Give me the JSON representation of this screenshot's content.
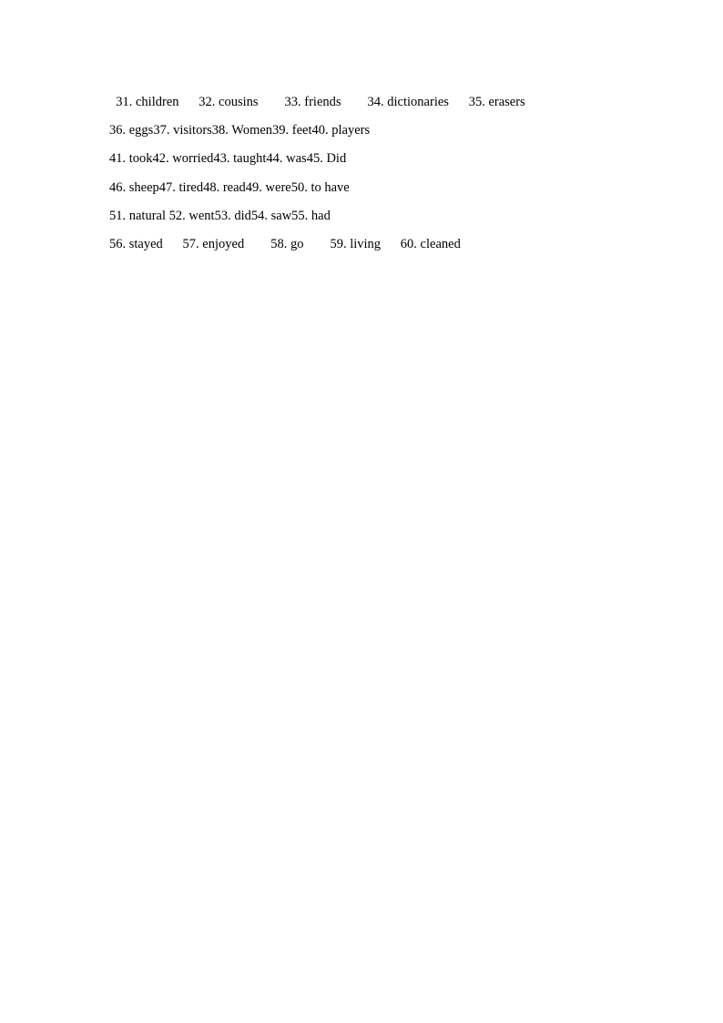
{
  "answers": {
    "rows": [
      {
        "indent": "  ",
        "items": [
          {
            "num": "31",
            "ans": "children",
            "after": "      "
          },
          {
            "num": "32",
            "ans": "cousins",
            "after": "        "
          },
          {
            "num": "33",
            "ans": "friends",
            "after": "        "
          },
          {
            "num": "34",
            "ans": "dictionaries",
            "after": "      "
          },
          {
            "num": "35",
            "ans": "erasers",
            "after": ""
          }
        ]
      },
      {
        "indent": "",
        "items": [
          {
            "num": "36",
            "ans": "eggs",
            "after": ""
          },
          {
            "num": "37",
            "ans": "visitors",
            "after": ""
          },
          {
            "num": "38",
            "ans": "Women",
            "after": ""
          },
          {
            "num": "39",
            "ans": "feet",
            "after": ""
          },
          {
            "num": "40",
            "ans": "players",
            "after": ""
          }
        ]
      },
      {
        "indent": "",
        "items": [
          {
            "num": "41",
            "ans": "took",
            "after": ""
          },
          {
            "num": "42",
            "ans": "worried",
            "after": ""
          },
          {
            "num": "43",
            "ans": "taught",
            "after": ""
          },
          {
            "num": "44",
            "ans": "was",
            "after": ""
          },
          {
            "num": "45",
            "ans": "Did",
            "after": ""
          }
        ]
      },
      {
        "indent": "",
        "items": [
          {
            "num": "46",
            "ans": "sheep",
            "after": ""
          },
          {
            "num": "47",
            "ans": "tired",
            "after": ""
          },
          {
            "num": "48",
            "ans": "read",
            "after": ""
          },
          {
            "num": "49",
            "ans": "were",
            "after": ""
          },
          {
            "num": "50",
            "ans": "to have",
            "after": ""
          }
        ]
      },
      {
        "indent": "",
        "items": [
          {
            "num": "51",
            "ans": "natural",
            "after": " "
          },
          {
            "num": "52",
            "ans": "went",
            "after": ""
          },
          {
            "num": "53",
            "ans": "did",
            "after": ""
          },
          {
            "num": "54",
            "ans": "saw",
            "after": ""
          },
          {
            "num": "55",
            "ans": "had",
            "after": ""
          }
        ]
      },
      {
        "indent": "",
        "items": [
          {
            "num": "56",
            "ans": "stayed",
            "after": "      "
          },
          {
            "num": "57",
            "ans": "enjoyed",
            "after": "        "
          },
          {
            "num": "58",
            "ans": "go",
            "after": "        "
          },
          {
            "num": "59",
            "ans": "living",
            "after": "      "
          },
          {
            "num": "60",
            "ans": "cleaned",
            "after": ""
          }
        ]
      }
    ],
    "separator": ". "
  }
}
